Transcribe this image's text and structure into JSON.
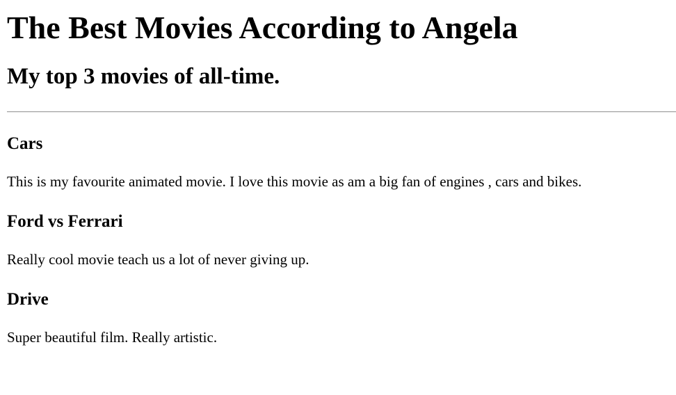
{
  "page": {
    "title": "The Best Movies According to Angela",
    "subtitle": "My top 3 movies of all-time."
  },
  "movies": [
    {
      "title": "Cars",
      "description": "This is my favourite animated movie. I love this movie as am a big fan of engines , cars and bikes."
    },
    {
      "title": "Ford vs Ferrari",
      "description": "Really cool movie teach us a lot of never giving up."
    },
    {
      "title": "Drive",
      "description": "Super beautiful film. Really artistic."
    }
  ]
}
